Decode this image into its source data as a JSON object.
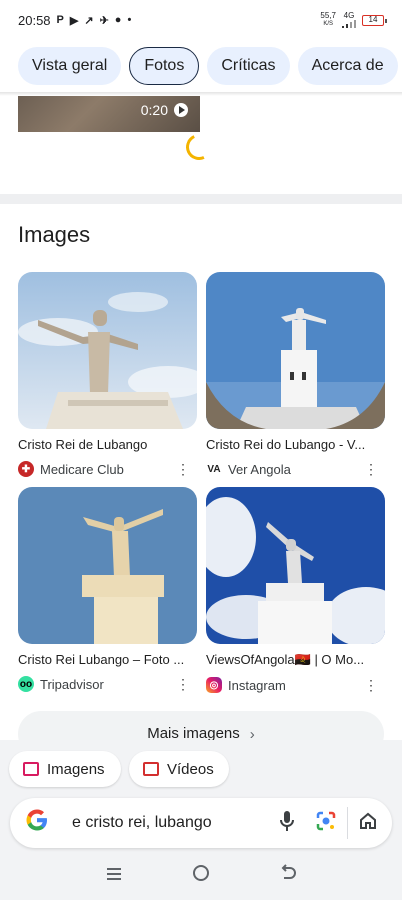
{
  "status_bar": {
    "time": "20:58",
    "left_icons": [
      "P",
      "▶",
      "↗",
      "✈",
      "●",
      "•"
    ],
    "net_speed_value": "55,7",
    "net_speed_unit": "K/S",
    "network": "4G",
    "battery": "14"
  },
  "tabs": [
    {
      "label": "Vista geral"
    },
    {
      "label": "Fotos"
    },
    {
      "label": "Críticas"
    },
    {
      "label": "Acerca de"
    }
  ],
  "video": {
    "duration": "0:20"
  },
  "images_section": {
    "title": "Images",
    "items": [
      {
        "title": "Cristo Rei de Lubango",
        "source": "Medicare Club"
      },
      {
        "title": "Cristo Rei do Lubango - V...",
        "source": "Ver Angola"
      },
      {
        "title": "Cristo Rei Lubango – Foto ...",
        "source": "Tripadvisor"
      },
      {
        "title": "ViewsOfAngola🇦🇴 | O Mo...",
        "source": "Instagram"
      }
    ],
    "more_label": "Mais imagens"
  },
  "chips": [
    {
      "label": "Imagens"
    },
    {
      "label": "Vídeos"
    }
  ],
  "search": {
    "query": "e cristo rei, lubango"
  },
  "colors": {
    "accent": "#1a73e8",
    "tab_bg": "#e8f0fe",
    "spinner": "#f4b400"
  }
}
